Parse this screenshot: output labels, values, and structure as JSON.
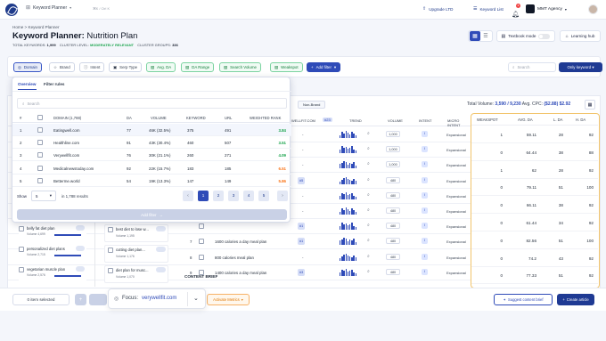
{
  "nav": {
    "app_label": "Keyword Planner",
    "hint": "⌘K / Ctrl K",
    "upgrade": "Upgrade LTD",
    "keyword_list": "Keyword List",
    "notif_count": "2",
    "agency": "MMT Agency"
  },
  "header": {
    "breadcrumb_home": "Home",
    "breadcrumb_sep": ">",
    "breadcrumb_current": "Keyword Planner",
    "title_prefix": "Keyword Planner:",
    "title_name": "Nutrition Plan",
    "stat_kw_label": "TOTAL KEYWORDS:",
    "stat_kw_value": "1,999",
    "stat_cluster_label": "CLUSTER LEVEL:",
    "stat_cluster_value": "MODERATELY RELEVANT",
    "stat_groups_label": "CLUSTER GROUPS:",
    "stat_groups_value": "336",
    "textbook_mode": "Textbook mode",
    "learning_hub": "Learning hub"
  },
  "filters": {
    "chips": [
      "Domain",
      "Brand",
      "Intent",
      "Serp Type",
      "Avg. DA",
      "DA Range",
      "Search Volume",
      "Weakspot"
    ],
    "add_filter": "Add filter",
    "search_placeholder": "Search",
    "keyword_dropdown": "Only keyword"
  },
  "bgtable": {
    "brand_chip": "Non-Brand",
    "total_volume_label": "Total Volume:",
    "total_volume_value": "3,590 / 9,230",
    "avg_cpc_label": "Avg. CPC:",
    "avg_cpc_value": "($2.88) $2.92",
    "columns": [
      "WELLFIT.COM",
      "#23",
      "TREND",
      "VOLUME",
      "INTENT",
      "MICRO INTENT"
    ],
    "rows": [
      {
        "num": "",
        "keyword": "",
        "pos": "-",
        "volume": "1,000",
        "intent": "I",
        "micro": "Expansional",
        "tag": ""
      },
      {
        "num": "",
        "keyword": "",
        "pos": "-",
        "volume": "1,000",
        "intent": "I",
        "micro": "Expansional",
        "tag": ""
      },
      {
        "num": "",
        "keyword": "",
        "pos": "-",
        "volume": "1,000",
        "intent": "I",
        "micro": "Expansional",
        "tag": ""
      },
      {
        "num": "",
        "keyword": "",
        "pos": "#5",
        "volume": "480",
        "intent": "I",
        "micro": "Expansional",
        "tag": "#5"
      },
      {
        "num": "",
        "keyword": "",
        "pos": "-",
        "volume": "480",
        "intent": "I",
        "micro": "Expansional",
        "tag": ""
      },
      {
        "num": "",
        "keyword": "",
        "pos": "-",
        "volume": "480",
        "intent": "I",
        "micro": "Expansional",
        "tag": ""
      },
      {
        "num": "",
        "keyword": "",
        "pos": "#1",
        "volume": "480",
        "intent": "I",
        "micro": "Expansional",
        "tag": "#1"
      },
      {
        "num": "7",
        "keyword": "1600 calories a day meal plan",
        "pos": "#1",
        "volume": "480",
        "intent": "I",
        "micro": "Expansional",
        "tag": "#1"
      },
      {
        "num": "8",
        "keyword": "800 calories meal plan",
        "pos": "-",
        "volume": "480",
        "intent": "I",
        "micro": "Expansional",
        "tag": ""
      },
      {
        "num": "9",
        "keyword": "1400 calories a day meal plan",
        "pos": "#3",
        "volume": "480",
        "intent": "I",
        "micro": "Expansional",
        "tag": "#3"
      }
    ],
    "content_brief": "CONTENT BRIEF"
  },
  "weakspot": {
    "columns": [
      "WEAKSPOT",
      "AVG. DA",
      "L. DA",
      "H. DA"
    ],
    "rows": [
      {
        "weakspot": "1",
        "avg": "59.11",
        "lda": "28",
        "hda": "92"
      },
      {
        "weakspot": "0",
        "avg": "64.44",
        "lda": "38",
        "hda": "88"
      },
      {
        "weakspot": "1",
        "avg": "62",
        "lda": "28",
        "hda": "92"
      },
      {
        "weakspot": "0",
        "avg": "79.11",
        "lda": "51",
        "hda": "100"
      },
      {
        "weakspot": "0",
        "avg": "66.11",
        "lda": "38",
        "hda": "92"
      },
      {
        "weakspot": "0",
        "avg": "61.44",
        "lda": "34",
        "hda": "92"
      },
      {
        "weakspot": "0",
        "avg": "82.56",
        "lda": "51",
        "hda": "100"
      },
      {
        "weakspot": "0",
        "avg": "74.2",
        "lda": "43",
        "hda": "92"
      },
      {
        "weakspot": "0",
        "avg": "77.33",
        "lda": "51",
        "hda": "92"
      },
      {
        "weakspot": "0",
        "avg": "79.11",
        "lda": "51",
        "hda": "100"
      }
    ]
  },
  "overlay": {
    "tab_overview": "Overview",
    "tab_filter_rules": "Filter rules",
    "search_placeholder": "Search",
    "columns": [
      "#",
      "DOMAIN (1,788)",
      "DA",
      "VOLUME",
      "KEYWORD",
      "URL",
      "WEIGHTED RANK"
    ],
    "rows": [
      {
        "n": "1",
        "domain": "Eatingwell.com",
        "da": "77",
        "volume": "46K (32.5%)",
        "keyword": "375",
        "url": "491",
        "rank": "3.84",
        "rank_color": "#16a34a"
      },
      {
        "n": "2",
        "domain": "Healthline.com",
        "da": "91",
        "volume": "43K (30.4%)",
        "keyword": "460",
        "url": "507",
        "rank": "3.51",
        "rank_color": "#16a34a"
      },
      {
        "n": "3",
        "domain": "Verywellfit.com",
        "da": "76",
        "volume": "30K (21.1%)",
        "keyword": "260",
        "url": "271",
        "rank": "4.09",
        "rank_color": "#16a34a"
      },
      {
        "n": "4",
        "domain": "Medicalnewstoday.com",
        "da": "92",
        "volume": "22K (15.7%)",
        "keyword": "183",
        "url": "185",
        "rank": "6.51",
        "rank_color": "#f97316"
      },
      {
        "n": "5",
        "domain": "Betterme.world",
        "da": "54",
        "volume": "19K (13.3%)",
        "keyword": "147",
        "url": "149",
        "rank": "5.86",
        "rank_color": "#f97316"
      }
    ],
    "show_label": "Show",
    "show_value": "5",
    "results_text": "in 1,788 results",
    "pages": [
      "1",
      "2",
      "3",
      "4",
      "5"
    ],
    "add_filter": "Add filter"
  },
  "clusters": {
    "left": [
      {
        "title": "belly fat diet plan",
        "volume": "Volume 4,699"
      },
      {
        "title": "personalized diet plans",
        "volume": "Volume 2,715"
      },
      {
        "title": "vegetarian muscle plan",
        "volume": "Volume 2,576"
      }
    ],
    "mid": [
      {
        "title": "best diet to lose w...",
        "volume": "Volume 1,195"
      },
      {
        "title": "cutting diet plan...",
        "volume": "Volume 1,176"
      },
      {
        "title": "diet plan for musc...",
        "volume": "Volume 1,070"
      }
    ]
  },
  "bottom": {
    "selected": "0 item selected",
    "focus_label": "Focus:",
    "focus_value": "verywellfit.com",
    "activate_metrics": "Activate Metrics",
    "suggest": "Suggest content brief",
    "create": "Create article"
  },
  "colors": {
    "primary": "#1f3a93",
    "accent_blue": "#2f4bb8",
    "weakspot_border": "#f2c46b",
    "green": "#16a34a",
    "orange": "#f97316"
  }
}
